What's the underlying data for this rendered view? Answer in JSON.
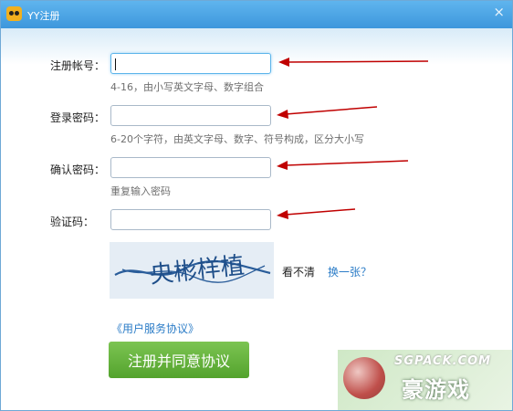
{
  "window": {
    "title": "YY注册",
    "close_glyph": "×"
  },
  "form": {
    "username": {
      "label": "注册帐号：",
      "value": "",
      "hint": "4-16，由小写英文字母、数字组合"
    },
    "password": {
      "label": "登录密码：",
      "value": "",
      "hint": "6-20个字符，由英文字母、数字、符号构成，区分大小写"
    },
    "confirm": {
      "label": "确认密码：",
      "value": "",
      "hint": "重复输入密码"
    },
    "captcha": {
      "label": "验证码：",
      "value": "",
      "image_text": "央彬样植"
    },
    "cant_see": "看不清",
    "refresh": "换一张？",
    "agreement": "《用户服务协议》",
    "submit": "注册并同意协议"
  },
  "watermark": {
    "url": "SGPACK.COM",
    "logo": "豪游戏"
  },
  "colors": {
    "titlebar": "#3d97dc",
    "link": "#2b7cc7",
    "button": "#5aa834",
    "arrow": "#c00000"
  }
}
